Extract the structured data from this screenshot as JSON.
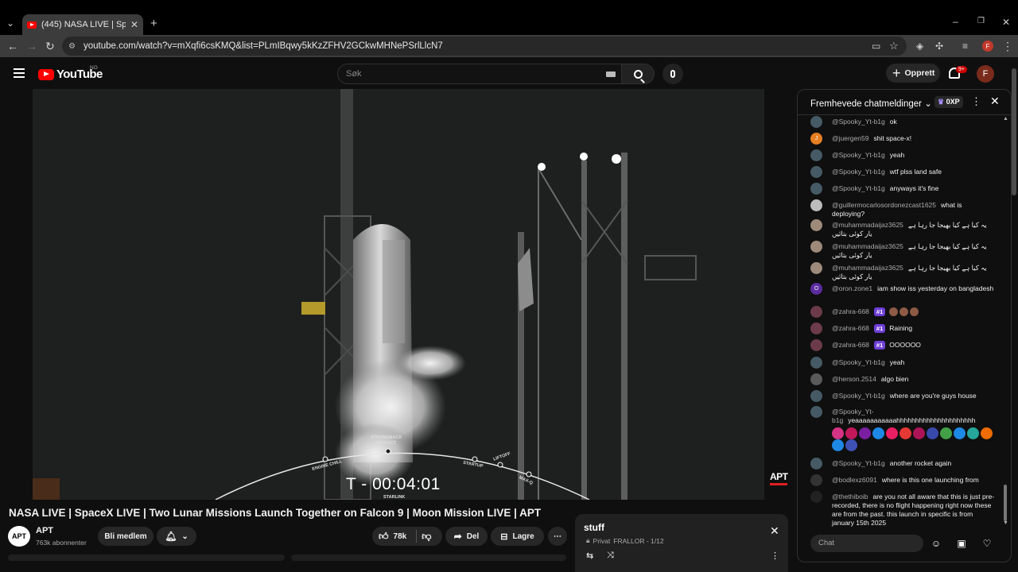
{
  "browser": {
    "tab_title": "(445) NASA LIVE | SpaceX LIVE |",
    "url": "youtube.com/watch?v=mXqfi6csKMQ&list=PLmIBqwy5kKzZFHV2GCkwMHNePSrlLlcN7"
  },
  "header": {
    "logo_text": "YouTube",
    "country": "NO",
    "search_placeholder": "Søk",
    "create_label": "Opprett",
    "notif_count": "9+",
    "avatar_letter": "F"
  },
  "video": {
    "countdown": "T - 00:04:01",
    "arc_labels": [
      "STRONGBACK",
      "RETRACT",
      "ENGINE CHILL",
      "STARTUP",
      "LIFTOFF",
      "MAX-Q",
      "STARLINK"
    ],
    "watermark": "APT"
  },
  "below": {
    "title": "NASA LIVE | SpaceX LIVE | Two Lunar Missions Launch Together on Falcon 9 | Moon Mission LIVE | APT",
    "channel": "APT",
    "channel_avatar": "APT",
    "subscribers": "763k abonnenter",
    "join_label": "Bli medlem",
    "likes": "78k",
    "share_label": "Del",
    "save_label": "Lagre"
  },
  "playlist": {
    "title": "stuff",
    "privacy": "Privat",
    "meta": "FRALLOR - 1/12"
  },
  "chat": {
    "title": "Fremhevede chatmeldinger",
    "xp": "0XP",
    "input_placeholder": "Chat",
    "messages": [
      {
        "author": "@Spooky_Yt-b1g",
        "text": "ok"
      },
      {
        "author": "@juergen59",
        "text": "shit space-x!"
      },
      {
        "author": "@Spooky_Yt-b1g",
        "text": "yeah"
      },
      {
        "author": "@Spooky_Yt-b1g",
        "text": "wtf plss land safe"
      },
      {
        "author": "@Spooky_Yt-b1g",
        "text": "anyways it's fine"
      },
      {
        "author": "@guillermocarlosordonezcast1625",
        "text": "what is deploying?"
      },
      {
        "author": "@muhammadaijaz3625",
        "text": "یہ کیا ہے کیا بھیجا جا رہا ہے یار کوئی بتائیں"
      },
      {
        "author": "@muhammadaijaz3625",
        "text": "یہ کیا ہے کیا بھیجا جا رہا ہے یار کوئی بتائیں"
      },
      {
        "author": "@muhammadaijaz3625",
        "text": "یہ کیا ہے کیا بھیجا جا رہا ہے یار کوئی بتائیں"
      },
      {
        "author": "@oron.zone1",
        "text": "iam show iss yesterday on bangladesh"
      },
      {
        "author": "@zahra-668",
        "badge": "#1",
        "text": ""
      },
      {
        "author": "@zahra-668",
        "badge": "#1",
        "text": "Raining"
      },
      {
        "author": "@zahra-668",
        "badge": "#1",
        "text": "OOOOOO"
      },
      {
        "author": "@Spooky_Yt-b1g",
        "text": "yeah"
      },
      {
        "author": "@herson.2514",
        "text": "algo bien"
      },
      {
        "author": "@Spooky_Yt-b1g",
        "text": "where are you're guys house"
      },
      {
        "author": "@Spooky_Yt-b1g",
        "text": "yeaaaaaaaaaaahhhhhhhhhhhhhhhhhhhhh"
      },
      {
        "author": "@Spooky_Yt-b1g",
        "text": "another rocket again"
      },
      {
        "author": "@bodlexz6091",
        "text": "where is this one launching from"
      },
      {
        "author": "@thethiboib",
        "text": "are you not all aware that this is just pre-recorded, there is no flight happening right now these are from the past. this launch in specific is from january 15th 2025"
      }
    ]
  }
}
